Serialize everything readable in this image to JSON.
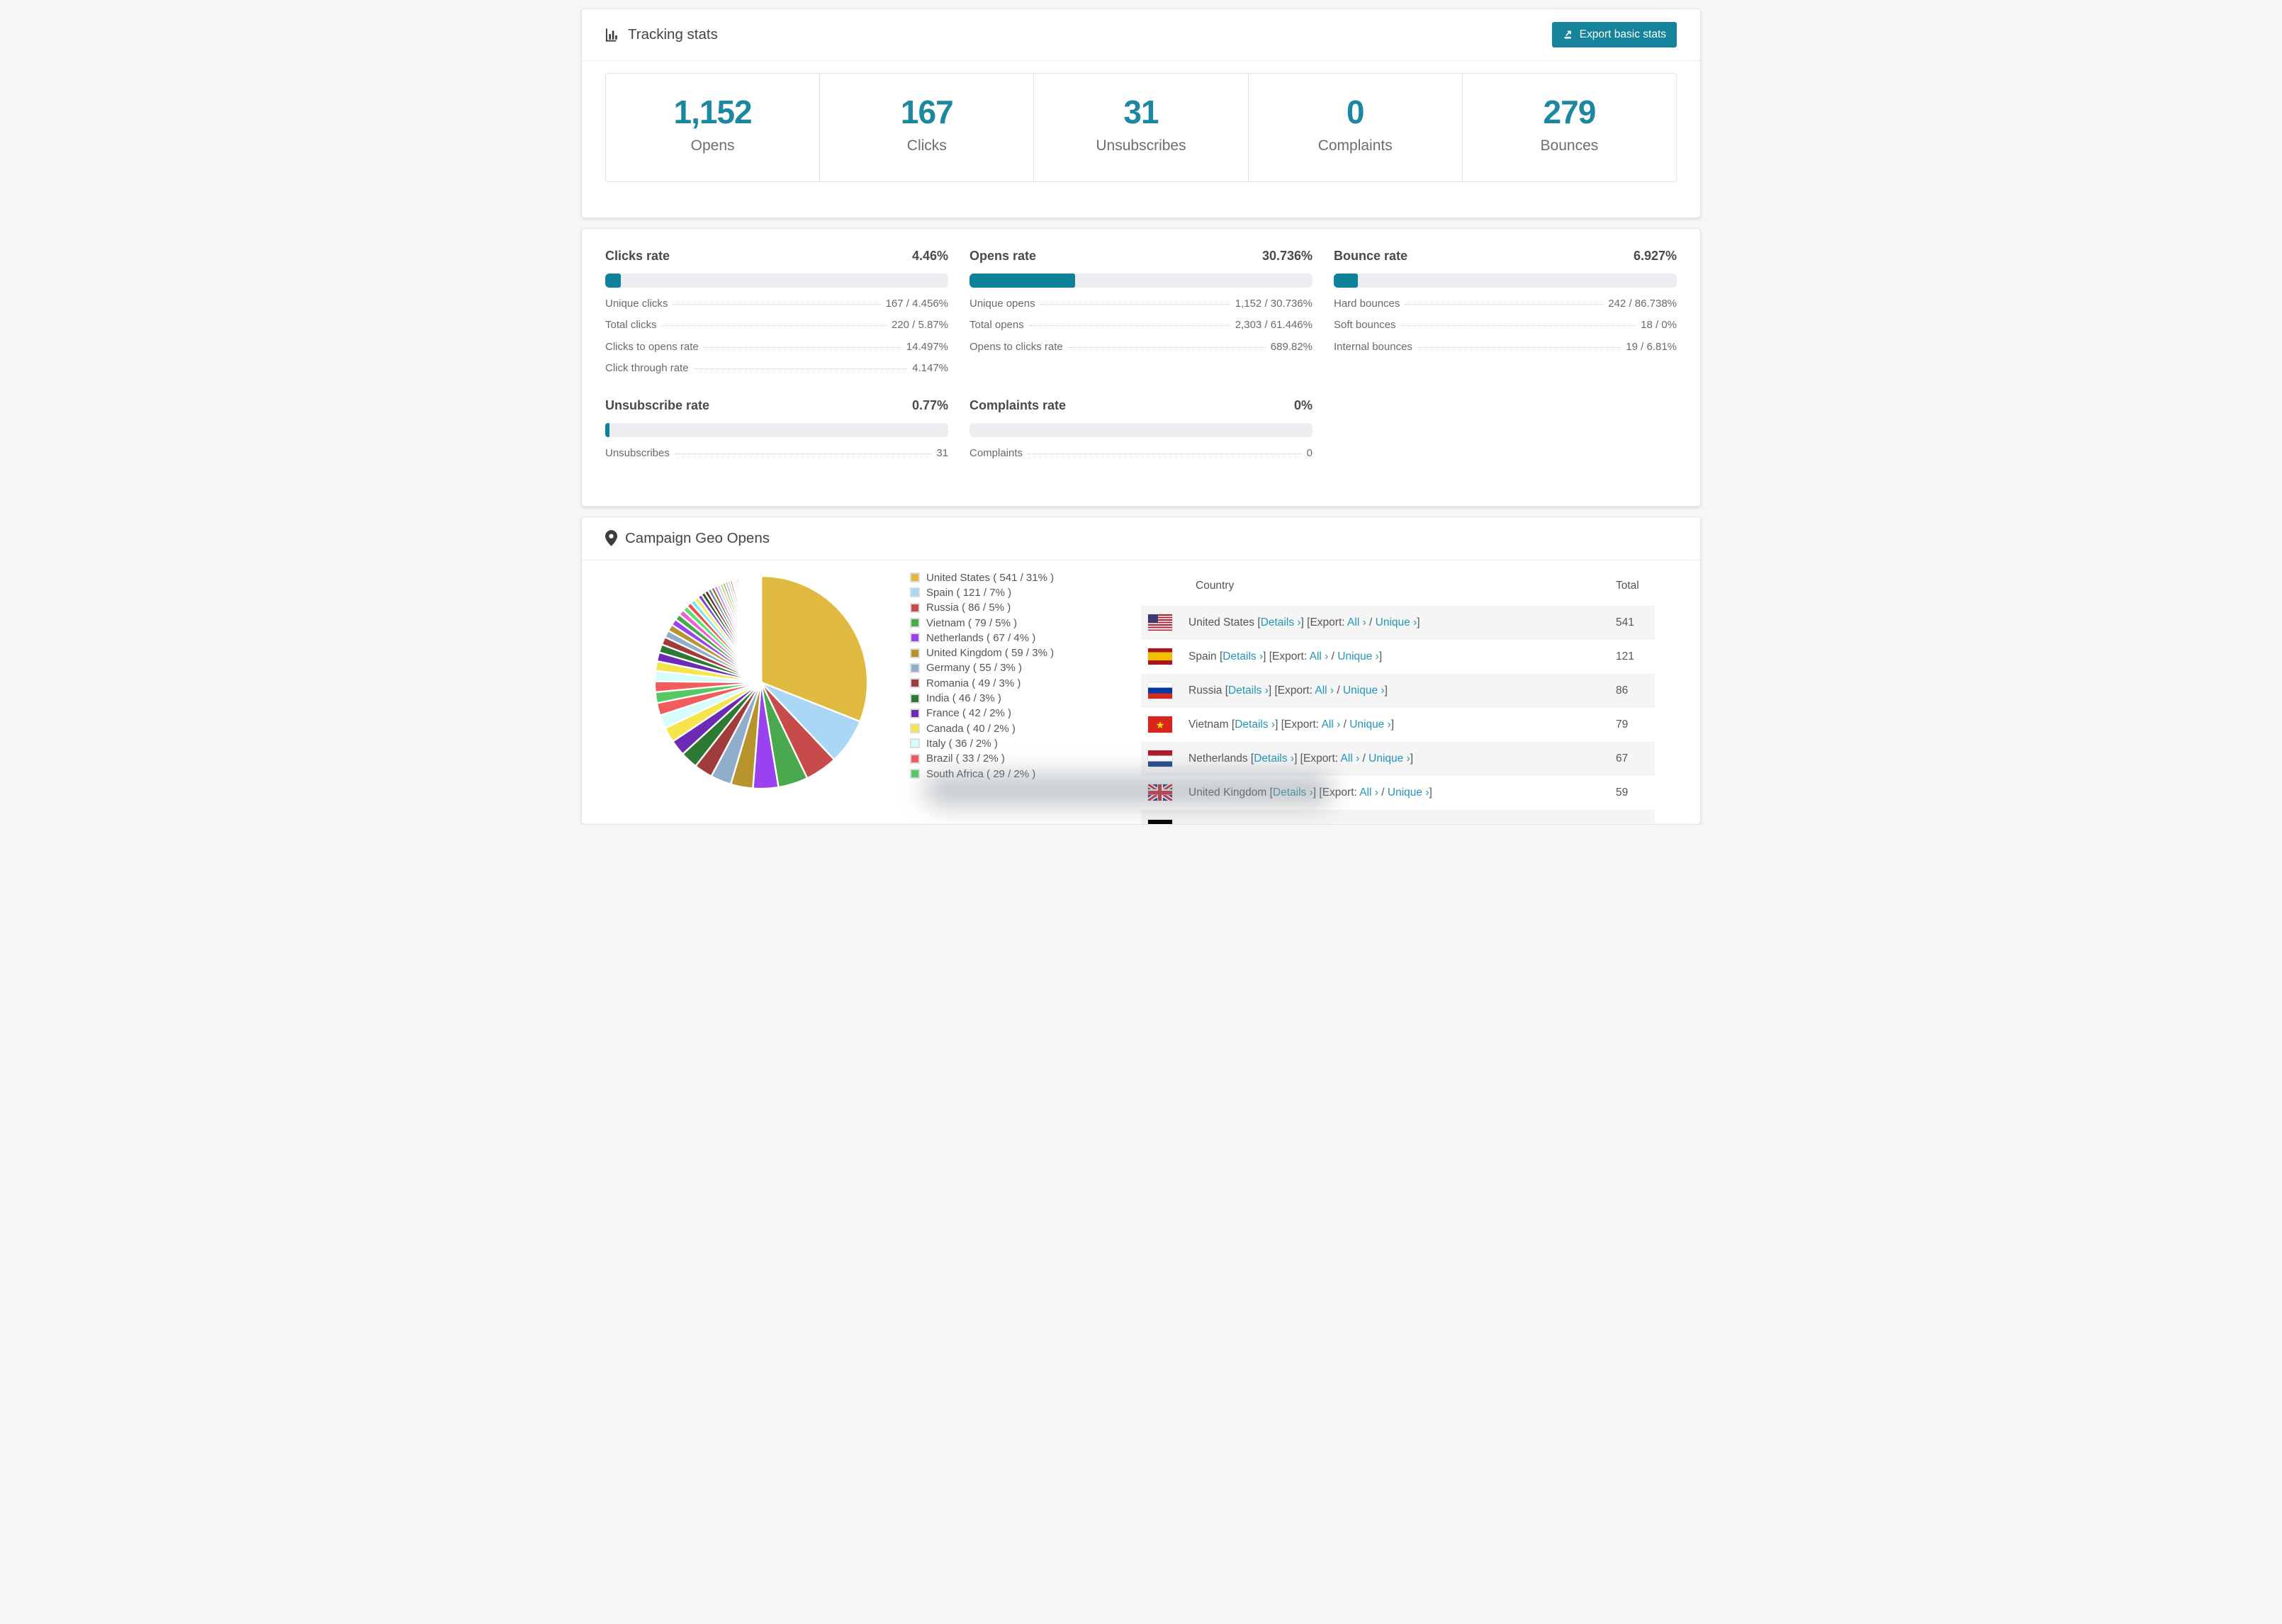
{
  "colors": {
    "accent_bar": "#0e829b",
    "accent_number": "#1b87a1",
    "accent_button": "#15839b",
    "link": "#2196ba",
    "page_bg": "#f5f6f7",
    "bar_track": "#eceef1"
  },
  "tracking": {
    "title": "Tracking stats",
    "export_button": "Export basic stats",
    "summary": [
      {
        "value": "1,152",
        "label": "Opens"
      },
      {
        "value": "167",
        "label": "Clicks"
      },
      {
        "value": "31",
        "label": "Unsubscribes"
      },
      {
        "value": "0",
        "label": "Complaints"
      },
      {
        "value": "279",
        "label": "Bounces"
      }
    ]
  },
  "rates": [
    {
      "title": "Clicks rate",
      "value": "4.46%",
      "percent": 4.46,
      "rows": [
        {
          "label": "Unique clicks",
          "value": "167 / 4.456%"
        },
        {
          "label": "Total clicks",
          "value": "220 / 5.87%"
        },
        {
          "label": "Clicks to opens rate",
          "value": "14.497%"
        },
        {
          "label": "Click through rate",
          "value": "4.147%"
        }
      ]
    },
    {
      "title": "Opens rate",
      "value": "30.736%",
      "percent": 30.736,
      "rows": [
        {
          "label": "Unique opens",
          "value": "1,152 / 30.736%"
        },
        {
          "label": "Total opens",
          "value": "2,303 / 61.446%"
        },
        {
          "label": "Opens to clicks rate",
          "value": "689.82%"
        }
      ]
    },
    {
      "title": "Bounce rate",
      "value": "6.927%",
      "percent": 6.927,
      "rows": [
        {
          "label": "Hard bounces",
          "value": "242 / 86.738%"
        },
        {
          "label": "Soft bounces",
          "value": "18 / 0%"
        },
        {
          "label": "Internal bounces",
          "value": "19 / 6.81%"
        }
      ]
    },
    {
      "title": "Unsubscribe rate",
      "value": "0.77%",
      "percent": 0.77,
      "rows": [
        {
          "label": "Unsubscribes",
          "value": "31"
        }
      ]
    },
    {
      "title": "Complaints rate",
      "value": "0%",
      "percent": 0,
      "rows": [
        {
          "label": "Complaints",
          "value": "0"
        }
      ]
    }
  ],
  "geo": {
    "title": "Campaign Geo Opens",
    "chart_data": {
      "type": "pie",
      "title": "Campaign Geo Opens",
      "labels": [
        "United States",
        "Spain",
        "Russia",
        "Vietnam",
        "Netherlands",
        "United Kingdom",
        "Germany",
        "Romania",
        "India",
        "France",
        "Canada",
        "Italy",
        "Brazil",
        "South Africa"
      ],
      "values": [
        541,
        121,
        86,
        79,
        67,
        59,
        55,
        49,
        46,
        42,
        40,
        36,
        33,
        29
      ],
      "percent_labels": [
        "31%",
        "7%",
        "5%",
        "5%",
        "4%",
        "3%",
        "3%",
        "3%",
        "3%",
        "2%",
        "2%",
        "2%",
        "2%",
        "2%"
      ],
      "colors": [
        "#e0b940",
        "#a9d7f5",
        "#c84b4b",
        "#4aa84e",
        "#9a41f0",
        "#b6932b",
        "#90aecb",
        "#a03c3c",
        "#2c7a33",
        "#6d2bb5",
        "#f6e44c",
        "#d5fdfd",
        "#f25c5c",
        "#57c964"
      ],
      "total_estimate": 1745,
      "legend_position": "right",
      "start_angle": -90,
      "direction": "clockwise",
      "unlabeled_tail_weights": [
        1.5,
        1.45,
        1.35,
        1.25,
        1.15,
        1.1,
        1.0,
        0.95,
        0.9,
        0.85,
        0.8,
        0.75,
        0.7,
        0.65,
        0.62,
        0.58,
        0.55,
        0.52,
        0.5,
        0.47,
        0.44,
        0.42,
        0.4,
        0.38,
        0.36,
        0.34,
        0.32,
        0.3,
        0.28,
        0.26,
        0.25,
        0.23,
        0.22,
        0.2,
        0.19,
        0.18,
        0.17,
        0.16,
        0.15,
        0.14,
        0.13,
        0.12,
        0.11,
        0.1,
        0.09,
        0.08,
        0.08,
        0.07,
        0.07,
        0.06,
        0.06,
        0.05,
        0.05,
        0.05,
        0.04,
        0.04,
        0.04,
        0.03,
        0.03,
        0.03
      ],
      "tail_palette": [
        "#f25c5c",
        "#d5fdfd",
        "#f6e44c",
        "#6d2bb5",
        "#2c7a33",
        "#a03c3c",
        "#90aecb",
        "#b6932b",
        "#9a41f0",
        "#4aa84e",
        "#ee5fd4",
        "#59e06b",
        "#e94f4f",
        "#7ce8f2",
        "#f2ee58",
        "#8a3be0",
        "#1f5e2a",
        "#7a2525",
        "#6888a8",
        "#8a6f1f",
        "#c46ef5",
        "#a9d7f5",
        "#e0b940",
        "#57c964",
        "#ff7ab0",
        "#66f08c"
      ]
    },
    "legend": [
      {
        "label": "United States ( 541 / 31% )",
        "color": "#e0b940"
      },
      {
        "label": "Spain ( 121 / 7% )",
        "color": "#a9d7f5"
      },
      {
        "label": "Russia ( 86 / 5% )",
        "color": "#c84b4b"
      },
      {
        "label": "Vietnam ( 79 / 5% )",
        "color": "#4aa84e"
      },
      {
        "label": "Netherlands ( 67 / 4% )",
        "color": "#9a41f0"
      },
      {
        "label": "United Kingdom ( 59 / 3% )",
        "color": "#b6932b"
      },
      {
        "label": "Germany ( 55 / 3% )",
        "color": "#90aecb"
      },
      {
        "label": "Romania ( 49 / 3% )",
        "color": "#a03c3c"
      },
      {
        "label": "India ( 46 / 3% )",
        "color": "#2c7a33"
      },
      {
        "label": "France ( 42 / 2% )",
        "color": "#6d2bb5"
      },
      {
        "label": "Canada ( 40 / 2% )",
        "color": "#f6e44c"
      },
      {
        "label": "Italy ( 36 / 2% )",
        "color": "#d5fdfd"
      },
      {
        "label": "Brazil ( 33 / 2% )",
        "color": "#f25c5c"
      },
      {
        "label": "South Africa ( 29 / 2% )",
        "color": "#57c964"
      }
    ],
    "table": {
      "headers": [
        "Country",
        "Total"
      ],
      "links": {
        "details": "Details ›",
        "export": "Export:",
        "all": "All ›",
        "unique": "Unique ›"
      },
      "rows": [
        {
          "flag": "us",
          "country": "United States",
          "total": "541"
        },
        {
          "flag": "es",
          "country": "Spain",
          "total": "121"
        },
        {
          "flag": "ru",
          "country": "Russia",
          "total": "86"
        },
        {
          "flag": "vn",
          "country": "Vietnam",
          "total": "79"
        },
        {
          "flag": "nl",
          "country": "Netherlands",
          "total": "67"
        },
        {
          "flag": "gb",
          "country": "United Kingdom",
          "total": "59"
        },
        {
          "flag": "de",
          "country": "",
          "total": "",
          "partial": true
        }
      ]
    }
  }
}
